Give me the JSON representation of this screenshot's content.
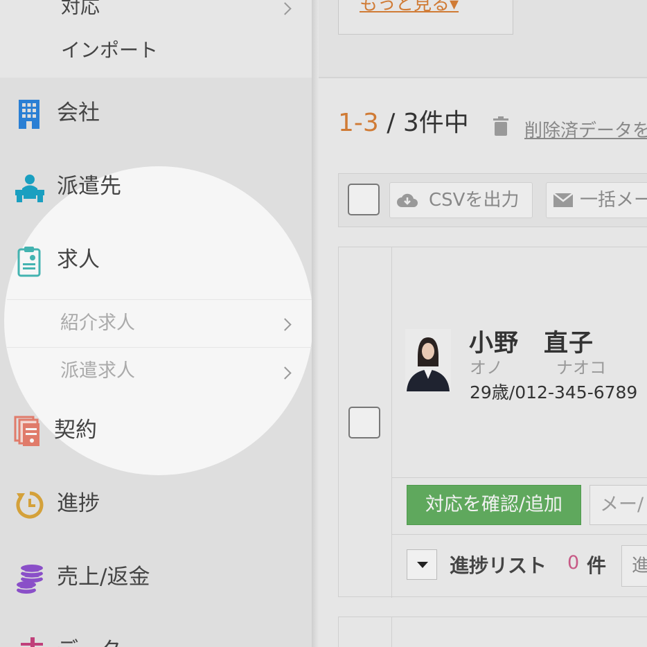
{
  "sidebar": {
    "top_items": [
      {
        "label": "対応"
      },
      {
        "label": "インポート"
      }
    ],
    "items": [
      {
        "label": "会社",
        "icon": "building-icon",
        "color": "#2a7fd4"
      },
      {
        "label": "派遣先",
        "icon": "desk-person-icon",
        "color": "#1a9fc0"
      },
      {
        "label": "求人",
        "icon": "clipboard-icon",
        "color": "#43b3b0"
      },
      {
        "label": "契約",
        "icon": "documents-icon",
        "color": "#e07b6a"
      },
      {
        "label": "進捗",
        "icon": "clock-refresh-icon",
        "color": "#d4a13a"
      },
      {
        "label": "売上/返金",
        "icon": "coin-stack-icon",
        "color": "#8a4fc8"
      },
      {
        "label": "データ",
        "icon": "chart-icon",
        "color": "#c0407a"
      }
    ],
    "job_subitems": [
      {
        "label": "紹介求人"
      },
      {
        "label": "派遣求人"
      }
    ]
  },
  "main": {
    "more_link": "もっと見る▾",
    "count_range": "1-3",
    "count_rest": " / 3件中",
    "deleted_link": "削除済データを",
    "toolbar": {
      "csv_label": "CSVを出力",
      "bulk_mail_label": "一括メー"
    },
    "card": {
      "name": "小野　直子",
      "kana_last": "オノ",
      "kana_first": "ナオコ",
      "info": "29歳/012-345-6789",
      "confirm_button": "対応を確認/追加",
      "mail_button": "メー/",
      "progress_label": "進捗リスト",
      "progress_count": "0",
      "progress_unit": "件",
      "progress_box": "進"
    },
    "accent_color": "#d07b35",
    "green_color": "#5fa85d"
  }
}
